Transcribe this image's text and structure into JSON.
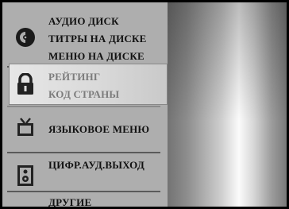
{
  "menu": {
    "groups": [
      {
        "icon": "disc-icon",
        "items": [
          "АУДИО ДИСК",
          "ТИТРЫ НА ДИСКЕ",
          "МЕНЮ НА ДИСКЕ"
        ]
      },
      {
        "icon": "lock-icon",
        "items": [
          "РЕЙТИНГ",
          "КОД СТРАНЫ"
        ]
      },
      {
        "icon": "tv-icon",
        "items": [
          "ЯЗЫКОВОЕ МЕНЮ"
        ]
      },
      {
        "icon": "speaker-icon",
        "items": [
          "ЦИФР.АУД.ВЫХОД"
        ]
      },
      {
        "icon": "",
        "items": [
          "ДРУГИЕ"
        ]
      }
    ]
  }
}
